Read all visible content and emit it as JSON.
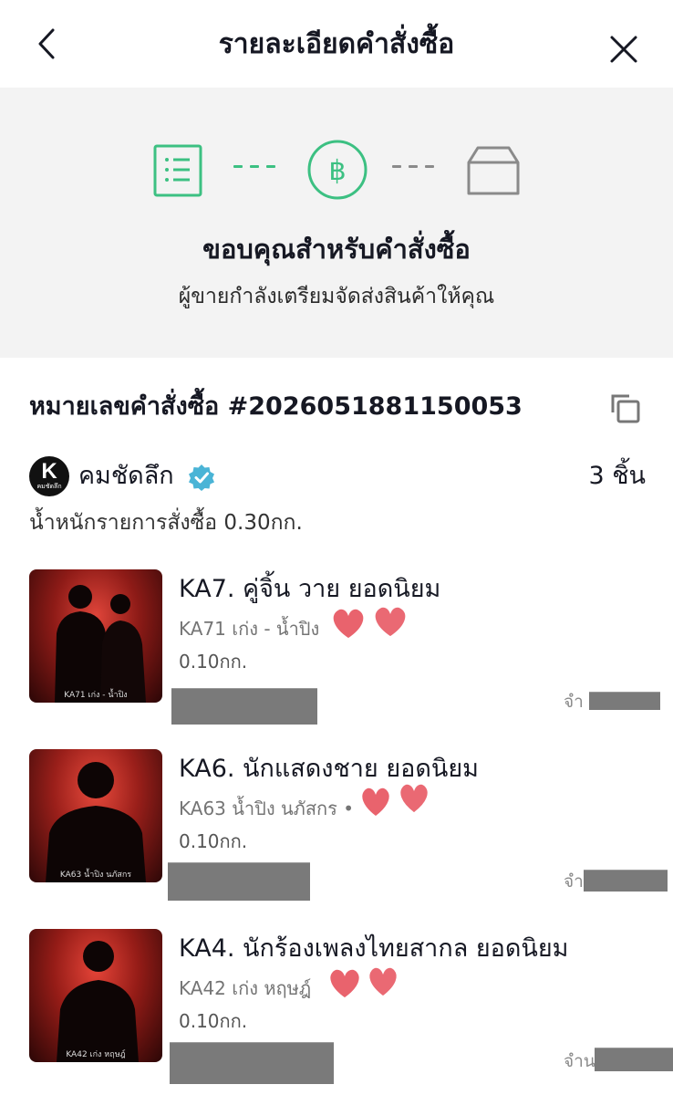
{
  "header": {
    "title": "รายละเอียดคำสั่งซื้อ",
    "back_icon": "chevron-left-icon",
    "close_icon": "close-icon"
  },
  "status": {
    "steps": [
      {
        "icon": "order-list-icon",
        "state": "done"
      },
      {
        "icon": "baht-payment-icon",
        "state": "done"
      },
      {
        "icon": "package-box-icon",
        "state": "pending"
      }
    ],
    "title": "ขอบคุณสำหรับคำสั่งซื้อ",
    "subtitle": "ผู้ขายกำลังเตรียมจัดส่งสินค้าให้คุณ",
    "accent_color": "#3cc082",
    "pending_color": "#8a8a8a"
  },
  "order": {
    "number_label": "หมายเลขคำสั่งซื้อ #2026051881150053",
    "copy_icon": "copy-icon"
  },
  "shop": {
    "logo_letter": "K",
    "logo_caption": "คมชัดลึก",
    "name": "คมชัดลึก",
    "verified_icon": "verified-badge-icon",
    "item_count": "3 ชิ้น",
    "order_weight": "น้ำหนักรายการสั่งซื้อ 0.30กก."
  },
  "products": [
    {
      "title": "KA7. คู่จิ้น วาย ยอดนิยม",
      "variant": "KA71 เก่ง - น้ำปิง",
      "weight": "0.10กก.",
      "qty_label": "จำ",
      "thumb_caption": "KA71 เก่ง - น้ำปิง"
    },
    {
      "title": "KA6. นักแสดงชาย ยอดนิยม",
      "variant": "KA63 น้ำปิง นภัสกร •",
      "weight": "0.10กก.",
      "qty_label": "จำ",
      "thumb_caption": "KA63 น้ำปิง นภัสกร"
    },
    {
      "title": "KA4. นักร้องเพลงไทยสากล ยอดนิยม",
      "variant": "KA42 เก่ง หฤษฎ์",
      "weight": "0.10กก.",
      "qty_label": "จำน",
      "thumb_caption": "KA42 เก่ง หฤษฎ์"
    }
  ]
}
